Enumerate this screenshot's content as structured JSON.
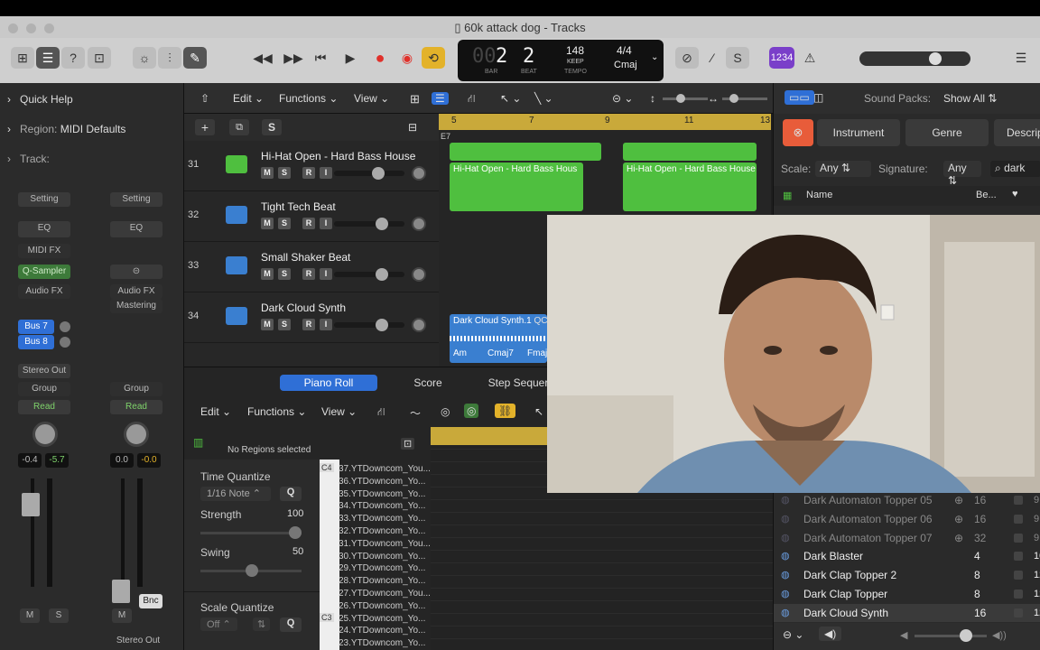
{
  "window": {
    "title": "60k attack dog - Tracks"
  },
  "transport": {
    "bar": "2",
    "beat": "2",
    "bar_prefix": "00",
    "bar_label": "BAR",
    "beat_label": "BEAT",
    "tempo": "148",
    "tempo_mode": "KEEP",
    "tempo_label": "TEMPO",
    "time_signature": "4/4",
    "key": "Cmaj",
    "count_in_badge": "1234"
  },
  "inspector": {
    "quick_help": "Quick Help",
    "region_prefix": "Region:",
    "region_value": "MIDI Defaults",
    "track": "Track:",
    "strip1": {
      "setting": "Setting",
      "eq": "EQ",
      "midi_fx": "MIDI FX",
      "instrument": "Q-Sampler",
      "audio_fx": "Audio FX",
      "bus1": "Bus 7",
      "bus2": "Bus 8",
      "output": "Stereo Out",
      "group": "Group",
      "automation": "Read",
      "val1": "-0.4",
      "val2": "-5.7",
      "mute": "M",
      "solo": "S"
    },
    "strip2": {
      "setting": "Setting",
      "eq": "EQ",
      "audio_fx": "Audio FX",
      "mastering": "Mastering",
      "group": "Group",
      "automation": "Read",
      "val1": "0.0",
      "val2": "-0.0",
      "bnc": "Bnc",
      "mute": "M",
      "output": "Stereo Out"
    }
  },
  "tracks_header": {
    "edit": "Edit",
    "functions": "Functions",
    "view": "View",
    "add": "+",
    "s": "S"
  },
  "tracks": [
    {
      "number": "31",
      "name": "Hi-Hat Open - Hard Bass House",
      "color": "#4fbf3f"
    },
    {
      "number": "32",
      "name": "Tight Tech Beat",
      "color": "#3a7fd0"
    },
    {
      "number": "33",
      "name": "Small Shaker Beat",
      "color": "#3a7fd0"
    },
    {
      "number": "34",
      "name": "Dark Cloud Synth",
      "color": "#3a7fd0"
    }
  ],
  "msr": {
    "m": "M",
    "s": "S",
    "r": "R",
    "i": "I"
  },
  "ruler": {
    "marks": [
      "5",
      "7",
      "9",
      "11",
      "13"
    ],
    "chord": "E7"
  },
  "regions": {
    "hihat1": "Hi-Hat Open - Hard Bass Hous",
    "hihat2": "Hi-Hat Open - Hard Bass House",
    "dark_cloud": "Dark Cloud Synth.1",
    "dark_cloud_tag": "QC",
    "chords": [
      "Am",
      "Cmaj7",
      "Fmaj"
    ]
  },
  "editor": {
    "tabs": {
      "piano_roll": "Piano Roll",
      "score": "Score",
      "step": "Step Sequer"
    },
    "edit": "Edit",
    "functions": "Functions",
    "view": "View",
    "no_regions": "No Regions selected",
    "time_quantize": "Time Quantize",
    "quantize_value": "1/16 Note",
    "q": "Q",
    "strength": "Strength",
    "strength_val": "100",
    "swing": "Swing",
    "swing_val": "50",
    "scale_quantize": "Scale Quantize",
    "scale_off": "Off",
    "c4": "C4",
    "c3": "C3",
    "notes": [
      "37.YTDowncom_You...",
      "36.YTDowncom_Yo...",
      "35.YTDowncom_Yo...",
      "34.YTDowncom_Yo...",
      "33.YTDowncom_Yo...",
      "32.YTDowncom_Yo...",
      "31.YTDowncom_You...",
      "30.YTDowncom_Yo...",
      "29.YTDowncom_Yo...",
      "28.YTDowncom_Yo...",
      "27.YTDowncom_You...",
      "26.YTDowncom_Yo...",
      "25.YTDowncom_Yo...",
      "24.YTDowncom_Yo...",
      "23.YTDowncom_Yo..."
    ]
  },
  "browser": {
    "sound_packs_label": "Sound Packs:",
    "sound_packs_value": "Show All",
    "filters": [
      "Instrument",
      "Genre",
      "Descrip"
    ],
    "scale_label": "Scale:",
    "scale_value": "Any",
    "signature_label": "Signature:",
    "signature_value": "Any",
    "search_value": "dark",
    "col_name": "Name",
    "col_beats": "Be...",
    "items": [
      {
        "name": "Dark Automaton Topper 05",
        "beats": "16",
        "dim": true,
        "k": "9"
      },
      {
        "name": "Dark Automaton Topper 06",
        "beats": "16",
        "dim": true,
        "k": "9"
      },
      {
        "name": "Dark Automaton Topper 07",
        "beats": "32",
        "dim": true,
        "k": "9"
      },
      {
        "name": "Dark Blaster",
        "beats": "4",
        "dim": false,
        "k": "10"
      },
      {
        "name": "Dark Clap Topper 2",
        "beats": "8",
        "dim": false,
        "k": "12"
      },
      {
        "name": "Dark Clap Topper",
        "beats": "8",
        "dim": false,
        "k": "12"
      },
      {
        "name": "Dark Cloud Synth",
        "beats": "16",
        "dim": false,
        "k": "12"
      }
    ]
  },
  "colors": {
    "green_region": "#4fbf3f",
    "blue_region": "#3a7fd0",
    "ruler": "#c9a93a",
    "accent_blue": "#2f6fd6",
    "record": "#e0302a",
    "cycle": "#e3b22a",
    "purple": "#7a3fc9"
  }
}
